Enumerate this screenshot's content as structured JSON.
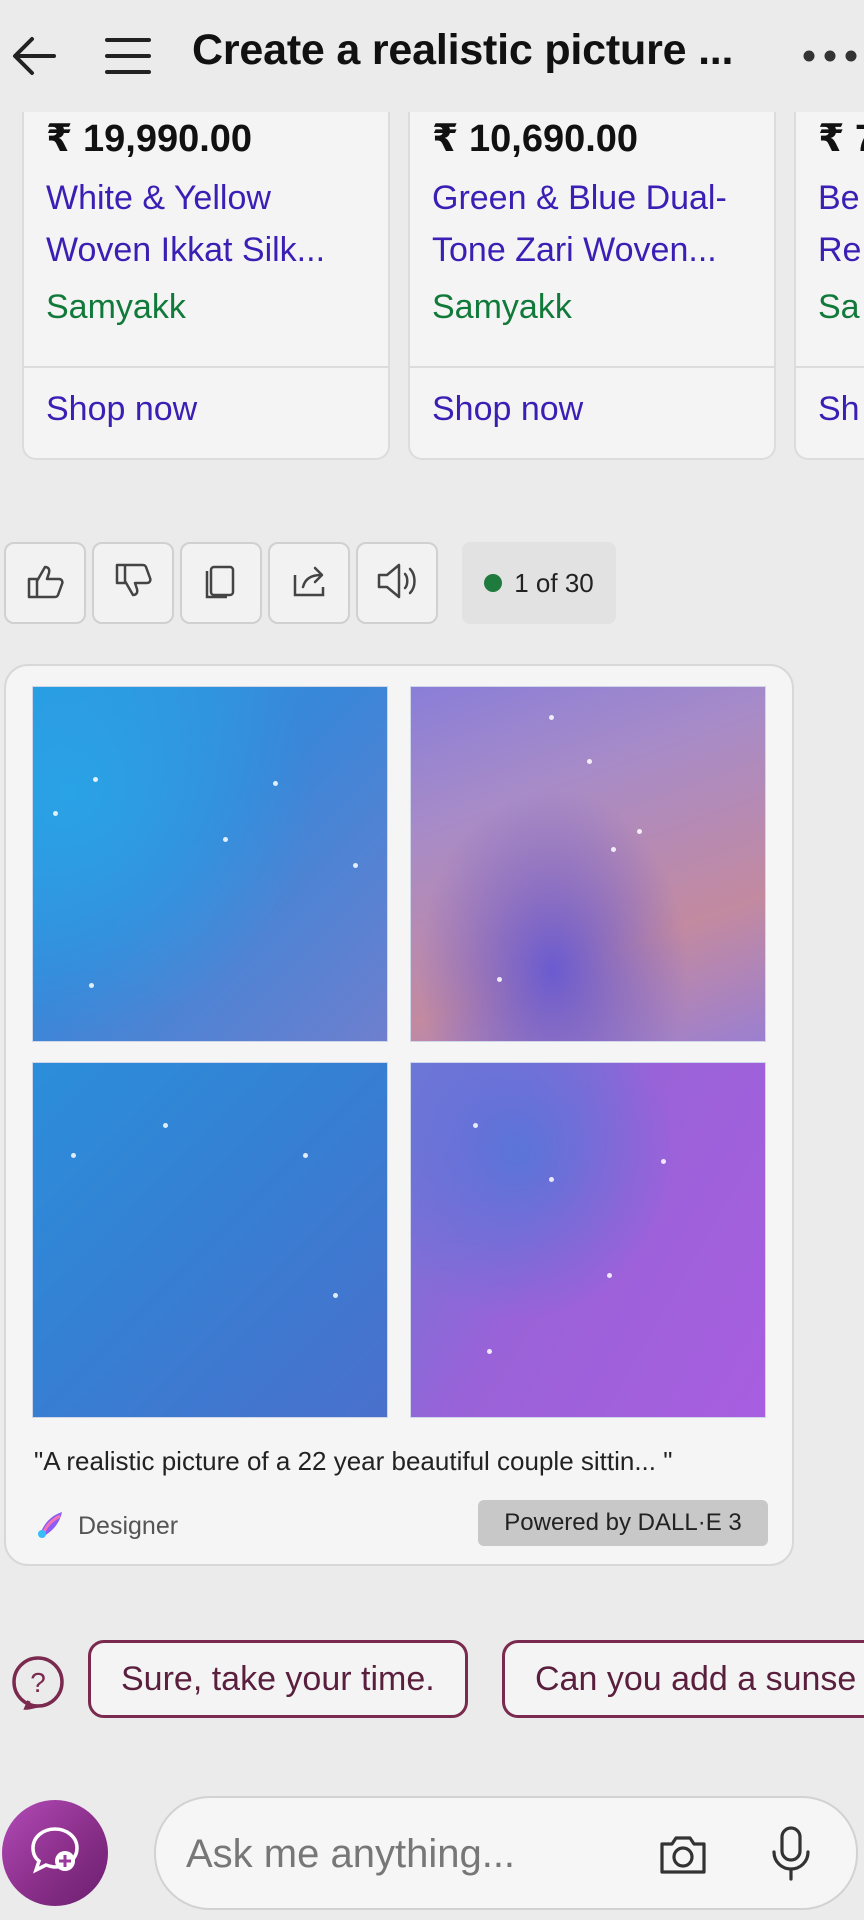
{
  "header": {
    "title": "Create a realistic picture ...",
    "back_icon": "arrow-left-icon",
    "menu_icon": "hamburger-menu-icon",
    "more_icon": "more-dots-icon"
  },
  "products": [
    {
      "price": "₹ 19,990.00",
      "title": "White & Yellow\nWoven Ikkat Silk...",
      "brand": "Samyakk",
      "action": "Shop now"
    },
    {
      "price": "₹ 10,690.00",
      "title": "Green & Blue Dual-\nTone Zari Woven...",
      "brand": "Samyakk",
      "action": "Shop now"
    },
    {
      "price": "₹ 7",
      "title": "Be\nRe",
      "brand": "Sa",
      "action": "Sh"
    }
  ],
  "toolbar": {
    "buttons": [
      "thumbs-up-icon",
      "thumbs-down-icon",
      "copy-icon",
      "share-icon",
      "read-aloud-icon"
    ],
    "counter": "1 of 30"
  },
  "designer_card": {
    "caption": "\"A realistic picture of a 22 year beautiful couple sittin... \"",
    "designer_label": "Designer",
    "powered_by": "Powered by DALL·E 3"
  },
  "suggestions": [
    "Sure, take your time.",
    "Can you add a sunse"
  ],
  "input": {
    "placeholder": "Ask me anything..."
  },
  "colors": {
    "background": "#ebebeb",
    "link_purple": "#3b1fb5",
    "brand_green": "#117a3a",
    "chip_border": "#7a2a4e",
    "new_chat": "#9a3a9e"
  }
}
